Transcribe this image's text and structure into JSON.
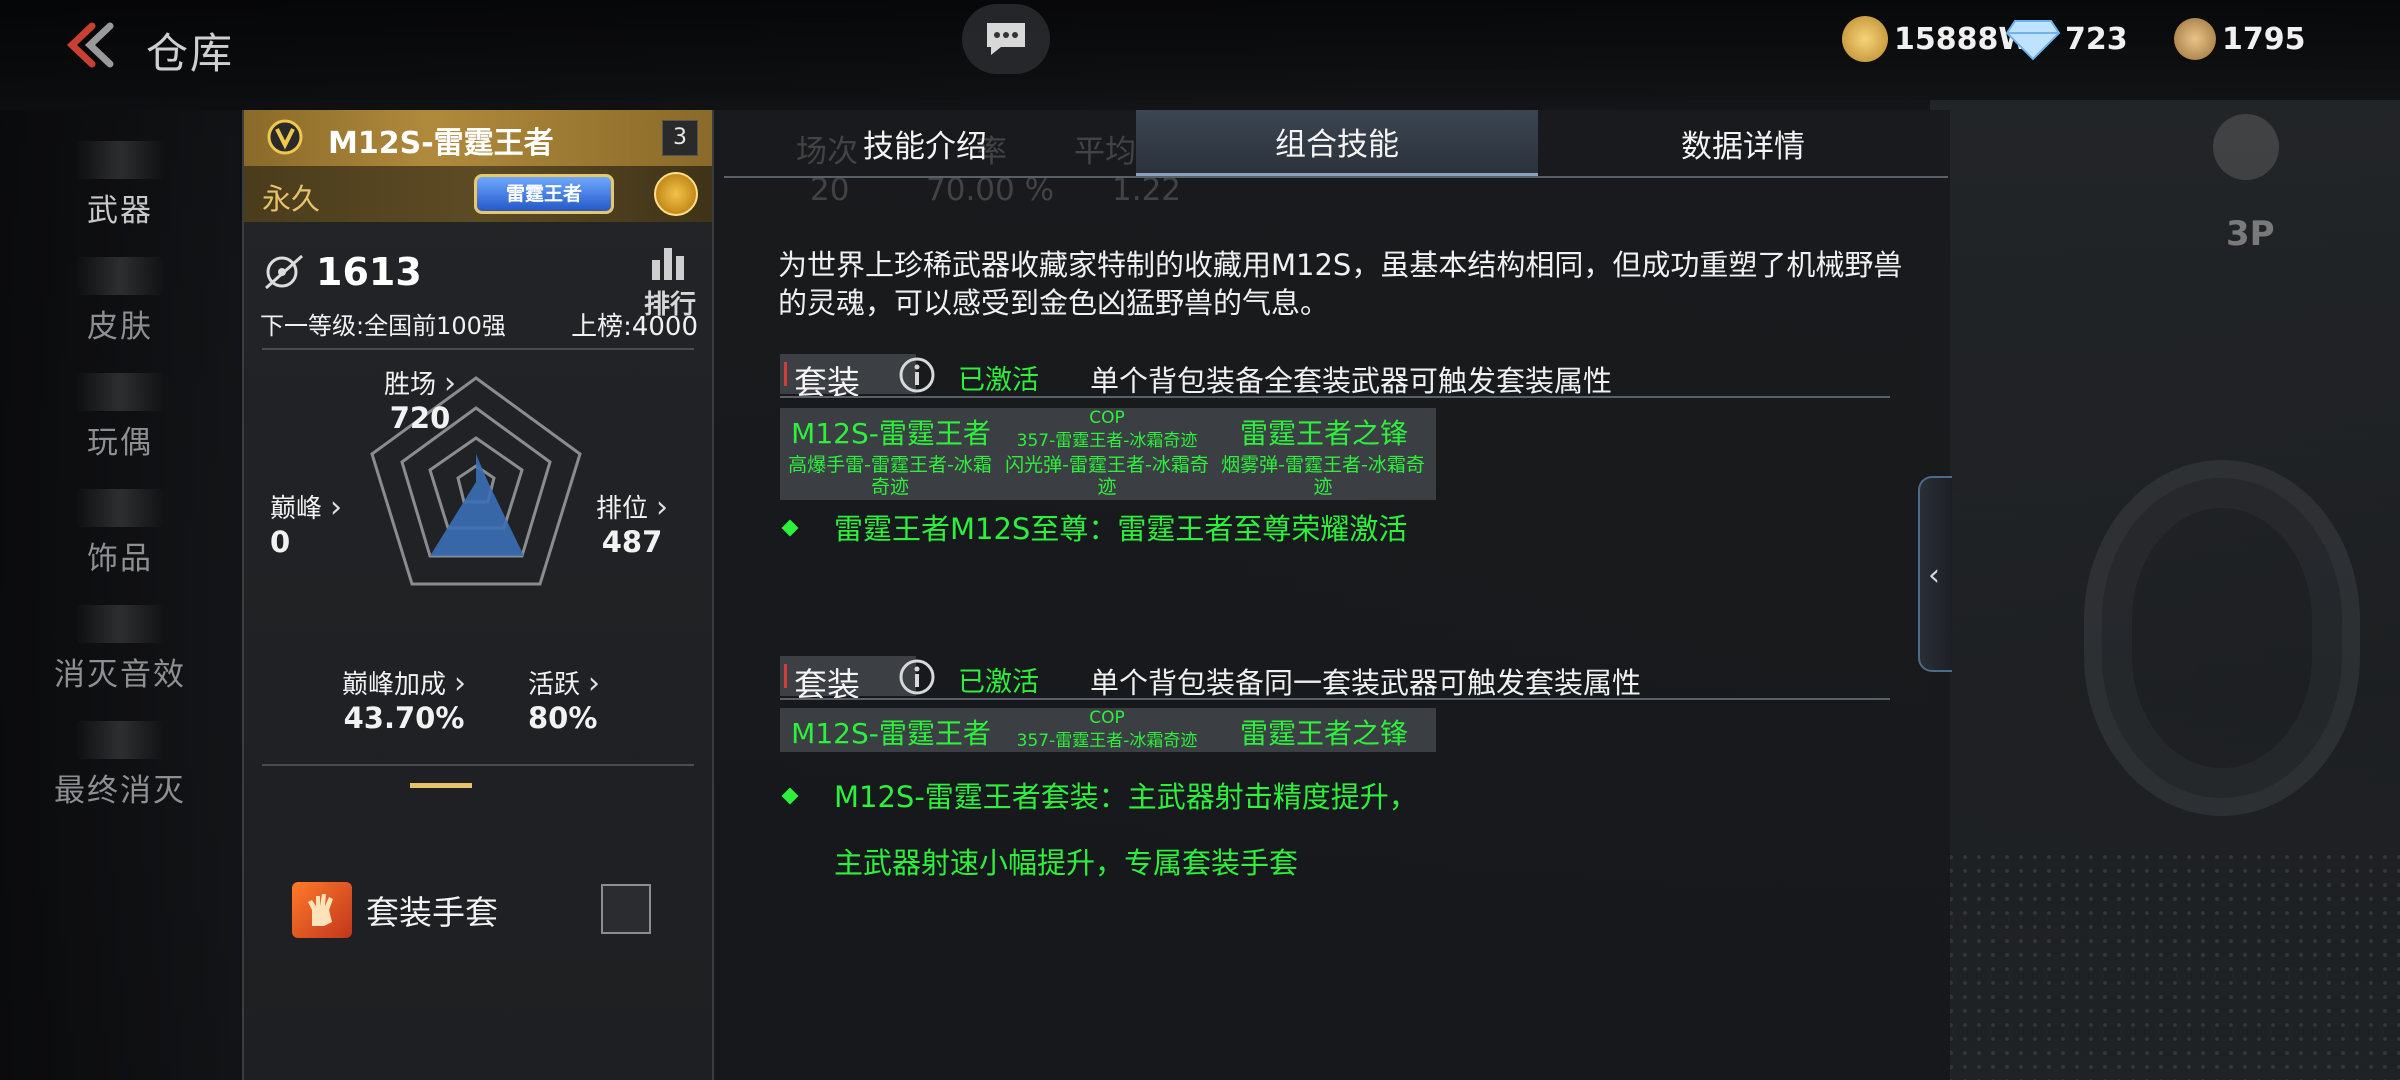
{
  "header": {
    "title": "仓库",
    "currencies": [
      {
        "name": "gold-coin-icon",
        "value": "15888W"
      },
      {
        "name": "diamond-icon",
        "value": "723"
      },
      {
        "name": "honor-coin-icon",
        "value": "1795"
      }
    ]
  },
  "sidebar": {
    "items": [
      {
        "label": "武器",
        "active": true
      },
      {
        "label": "皮肤"
      },
      {
        "label": "玩偶"
      },
      {
        "label": "饰品"
      },
      {
        "label": "消灭音效"
      },
      {
        "label": "最终消灭"
      }
    ]
  },
  "weapon": {
    "name": "M12S-雷霆王者",
    "level": "3",
    "duration": "永久",
    "badge": "雷霆王者",
    "kills": "1613",
    "rank_label": "排行",
    "next_level": "下一等级:全国前100强",
    "on_board": "上榜:4000",
    "stats": {
      "wins_label": "胜场",
      "wins": "720",
      "peak_label": "巅峰",
      "peak": "0",
      "rank_label": "排位",
      "rank": "487",
      "peak_bonus_label": "巅峰加成",
      "peak_bonus": "43.70%",
      "active_label": "活跃",
      "active": "80%"
    },
    "glove_label": "套装手套",
    "glove_checked": false
  },
  "ghost_stats": {
    "matches_label": "场次",
    "matches": "20",
    "winrate_label": "率",
    "winrate": "70.00 %",
    "kda_label": "平均KDA",
    "kda": "1.22"
  },
  "tabs": [
    {
      "label": "技能介绍"
    },
    {
      "label": "组合技能",
      "active": true
    },
    {
      "label": "数据详情"
    }
  ],
  "description": "为世界上珍稀武器收藏家特制的收藏用M12S，虽基本结构相同，但成功重塑了机械野兽的灵魂，可以感受到金色凶猛野兽的气息。",
  "suits": [
    {
      "tag": "套装",
      "status": "已激活",
      "rule": "单个背包装备全套装武器可触发套装属性",
      "items_row1": [
        "M12S-雷霆王者",
        "COP",
        "357-雷霆王者-冰霜奇迹",
        "雷霆王者之锋"
      ],
      "items_row2": [
        "高爆手雷-雷霆王者-冰霜奇迹",
        "闪光弹-雷霆王者-冰霜奇迹",
        "烟雾弹-雷霆王者-冰霜奇迹"
      ],
      "effect": "雷霆王者M12S至尊：雷霆王者至尊荣耀激活"
    },
    {
      "tag": "套装",
      "status": "已激活",
      "rule": "单个背包装备同一套装武器可触发套装属性",
      "items_row1": [
        "M12S-雷霆王者",
        "COP",
        "357-雷霆王者-冰霜奇迹",
        "雷霆王者之锋"
      ],
      "effect": "M12S-雷霆王者套装：主武器射击精度提升，主武器射速小幅提升，专属套装手套"
    }
  ],
  "side": {
    "view_mode": "3P"
  },
  "colors": {
    "accent_green": "#2df03c",
    "gold": "#b08a3c",
    "tab_active": "#3c4552"
  }
}
